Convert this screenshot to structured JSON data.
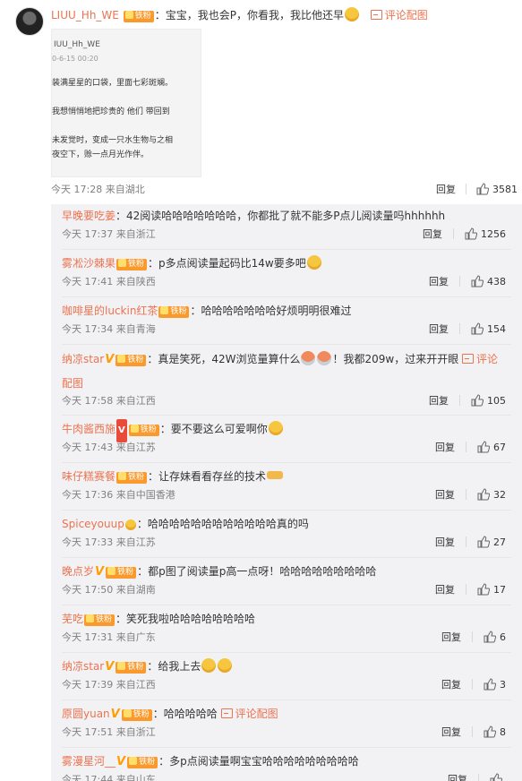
{
  "main_comment": {
    "username": "LIUU_Hh_WE",
    "fan_badge": "铁粉",
    "text": "：宝宝，我也会P，你看我，我比他还早",
    "emoji_icon": "crying-laugh-emoji",
    "comment_image_label": "评论配图",
    "screenshot": {
      "username": "IUU_Hh_WE",
      "date": "0-6-15 00:20",
      "lines": [
        "装满星星的口袋，里面七彩斑斓。",
        "我想悄悄地把珍贵的 他们 带回到",
        "未发觉时，变成一只水生物与之相",
        "夜空下，赊一点月光作伴。"
      ]
    },
    "time": "今天 17:28 来自湖北",
    "reply_label": "回复",
    "likes": "3581"
  },
  "replies": [
    {
      "username": "早晚要吃姜",
      "text": "：42阅读哈哈哈哈哈哈哈，你都批了就不能多P点儿阅读量吗hhhhhh",
      "time": "今天 17:37 来自浙江",
      "reply_label": "回复",
      "likes": "1256"
    },
    {
      "username": "雾凇沙棘果",
      "badge": "铁粉",
      "text": "：p多点阅读量起码比14w要多吧",
      "time": "今天 17:41 来自陕西",
      "reply_label": "回复",
      "likes": "438"
    },
    {
      "username": "咖啡星的luckin红茶",
      "badge": "铁粉",
      "text": "：哈哈哈哈哈哈哈好烦明明很难过",
      "time": "今天 17:34 来自青海",
      "reply_label": "回复",
      "likes": "154"
    },
    {
      "username": "纳凉star",
      "badge": "铁粉",
      "text": "：真是笑死，42W浏览量算什么",
      "text2": "！我都209w，过来开开眼",
      "image_label": "评论配图",
      "time": "今天 17:58 来自江西",
      "reply_label": "回复",
      "likes": "105"
    },
    {
      "username": "牛肉酱西施",
      "badge": "铁粉",
      "text": "：要不要这么可爱啊你",
      "time": "今天 17:43 来自江苏",
      "reply_label": "回复",
      "likes": "67"
    },
    {
      "username": "味仔糕赛餐",
      "badge": "铁粉",
      "text": "：让存妹看看存丝的技术",
      "time": "今天 17:36 来自中国香港",
      "reply_label": "回复",
      "likes": "32"
    },
    {
      "username": "Spiceyouup",
      "text": "：哈哈哈哈哈哈哈哈哈哈哈哈真的吗",
      "time": "今天 17:33 来自江苏",
      "reply_label": "回复",
      "likes": "27"
    },
    {
      "username": "晚点岁",
      "badge": "铁粉",
      "text": "：都p图了阅读量p高一点呀！哈哈哈哈哈哈哈哈哈",
      "time": "今天 17:50 来自湖南",
      "reply_label": "回复",
      "likes": "17"
    },
    {
      "username": "芜吃",
      "badge": "铁粉",
      "text": "：笑死我啦哈哈哈哈哈哈哈哈",
      "time": "今天 17:31 来自广东",
      "reply_label": "回复",
      "likes": "6"
    },
    {
      "username": "纳凉star",
      "badge": "铁粉",
      "text": "：给我上去",
      "time": "今天 17:39 来自江西",
      "reply_label": "回复",
      "likes": "3"
    },
    {
      "username": "原圆yuan",
      "badge": "铁粉",
      "text": "：哈哈哈哈哈",
      "image_label": "评论配图",
      "time": "今天 17:51 来自浙江",
      "reply_label": "回复",
      "likes": "8"
    },
    {
      "username": "雾漫星河__",
      "badge": "铁粉",
      "text": "：多p点阅读量啊宝宝哈哈哈哈哈哈哈哈哈",
      "time": "今天 17:44 来自山东",
      "reply_label": "回复",
      "likes": ""
    }
  ],
  "colors": {
    "username": "#eb7350",
    "panel_bg": "#f2f2f5",
    "badge": "#fa9a2c",
    "meta": "#808080"
  }
}
